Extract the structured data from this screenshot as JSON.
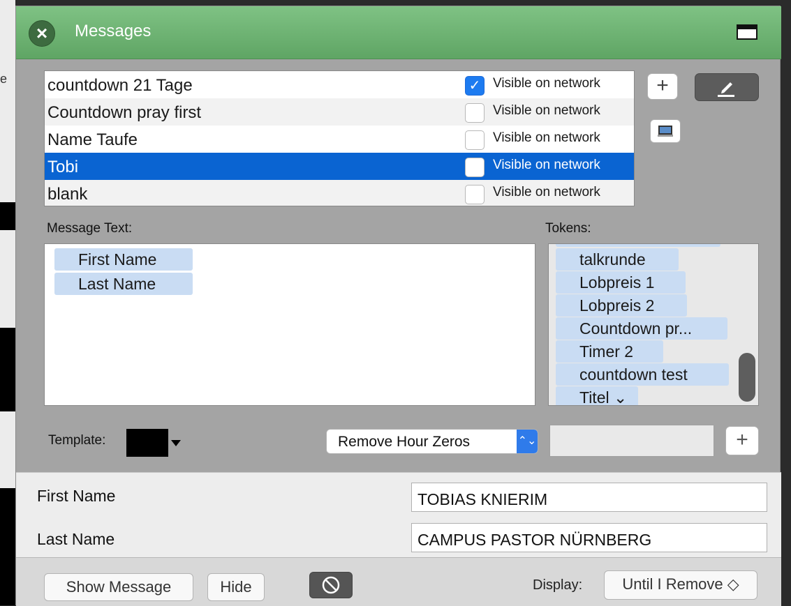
{
  "window": {
    "title": "Messages"
  },
  "background": {
    "letter": "e",
    "caret": "▼"
  },
  "messages": [
    {
      "name": "countdown 21 Tage",
      "visible_label": "Visible on network",
      "checked": true,
      "selected": false
    },
    {
      "name": "Countdown pray first",
      "visible_label": "Visible on network",
      "checked": false,
      "selected": false
    },
    {
      "name": "Name Taufe",
      "visible_label": "Visible on network",
      "checked": false,
      "selected": false
    },
    {
      "name": "Tobi",
      "visible_label": "Visible on network",
      "checked": false,
      "selected": true
    },
    {
      "name": "blank",
      "visible_label": "Visible on network",
      "checked": false,
      "selected": false
    }
  ],
  "toolbar": {
    "add_label": "+",
    "edit_icon": "pencil-icon",
    "monitor_icon": "monitor-icon"
  },
  "message_text": {
    "label": "Message Text:",
    "tokens": [
      "First Name",
      "Last Name"
    ]
  },
  "tokens": {
    "label": "Tokens:",
    "items": [
      "talkrunde",
      "Lobpreis 1",
      "Lobpreis 2",
      "Countdown pr...",
      "Timer 2",
      "countdown test",
      "Titel ⌄"
    ]
  },
  "template": {
    "label": "Template:",
    "option_selected": "Remove Hour Zeros",
    "option_arrow": "⌃⌄",
    "add_label": "+"
  },
  "fields": [
    {
      "label": "First Name",
      "value": "TOBIAS KNIERIM"
    },
    {
      "label": "Last Name",
      "value": "CAMPUS PASTOR NÜRNBERG"
    }
  ],
  "footer": {
    "show_message": "Show Message",
    "hide": "Hide",
    "display_label": "Display:",
    "display_value": "Until I Remove ◇"
  },
  "colors": {
    "titlebar": "#6fb574",
    "selection": "#0a64d2",
    "token_bg": "#c9dcf3",
    "checkbox_on": "#1d7bf0"
  }
}
